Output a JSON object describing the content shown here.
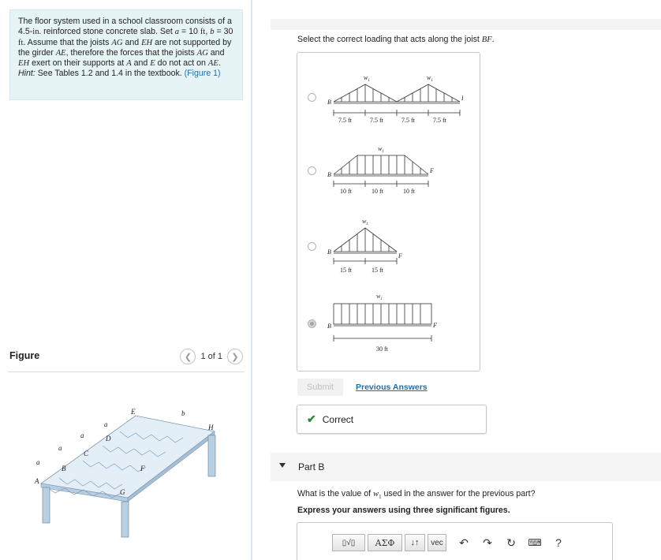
{
  "problem": {
    "text_parts": [
      "The floor system used in a school classroom consists of a 4.5-",
      "in.",
      " reinforced stone concrete slab. Set ",
      "a",
      " = 10 ",
      "ft",
      ", ",
      "b",
      " = 30 ",
      "ft",
      ". Assume that the joists ",
      "AG",
      " and ",
      "EH",
      " are not supported by the girder ",
      "AE",
      ", therefore the forces that the joists ",
      "AG",
      " and ",
      "EH",
      " exert on their supports at ",
      "A",
      " and ",
      "E",
      " do not act on ",
      "AE",
      ". ",
      "Hint:",
      " See Tables 1.2 and 1.4 in the textbook. ",
      "(Figure 1)"
    ]
  },
  "figure": {
    "title": "Figure",
    "pager_text": "1 of 1",
    "prev_icon": "chevron-left-icon",
    "next_icon": "chevron-right-icon",
    "labels": [
      "E",
      "b",
      "H",
      "a",
      "D",
      "a",
      "C",
      "a",
      "B",
      "F",
      "a",
      "A",
      "G"
    ]
  },
  "partA": {
    "question_prefix": "Select the correct loading that acts along the joist ",
    "question_var": "BF",
    "question_suffix": ".",
    "options": [
      {
        "selected": false,
        "load_label": "w",
        "load_sub": "1",
        "end_left": "B",
        "end_right": "F",
        "spans": [
          "7.5 ft",
          "7.5 ft",
          "7.5 ft",
          "7.5 ft"
        ]
      },
      {
        "selected": false,
        "load_label": "w",
        "load_sub": "1",
        "end_left": "B",
        "end_right": "F",
        "spans": [
          "10 ft",
          "10 ft",
          "10 ft"
        ]
      },
      {
        "selected": false,
        "load_label": "w",
        "load_sub": "1",
        "end_left": "B",
        "end_right": "F",
        "spans": [
          "15 ft",
          "15 ft"
        ]
      },
      {
        "selected": true,
        "load_label": "w",
        "load_sub": "1",
        "end_left": "B",
        "end_right": "F",
        "spans": [
          "30 ft"
        ]
      }
    ],
    "submit_label": "Submit",
    "previous_answers_label": "Previous Answers",
    "feedback": "Correct"
  },
  "partB": {
    "title": "Part B",
    "question_prefix": "What is the value of ",
    "question_var": "w",
    "question_sub": "1",
    "question_suffix": " used in the answer for the previous part?",
    "instruction": "Express your answers using three significant figures.",
    "toolbar": {
      "templates_label": "▯√▯",
      "greek_label": "ΑΣΦ",
      "arrows_label": "↓↑",
      "vec_label": "vec",
      "undo_icon": "undo-icon",
      "redo_icon": "redo-icon",
      "reset_icon": "reset-icon",
      "keyboard_icon": "keyboard-icon",
      "help_label": "?"
    }
  }
}
